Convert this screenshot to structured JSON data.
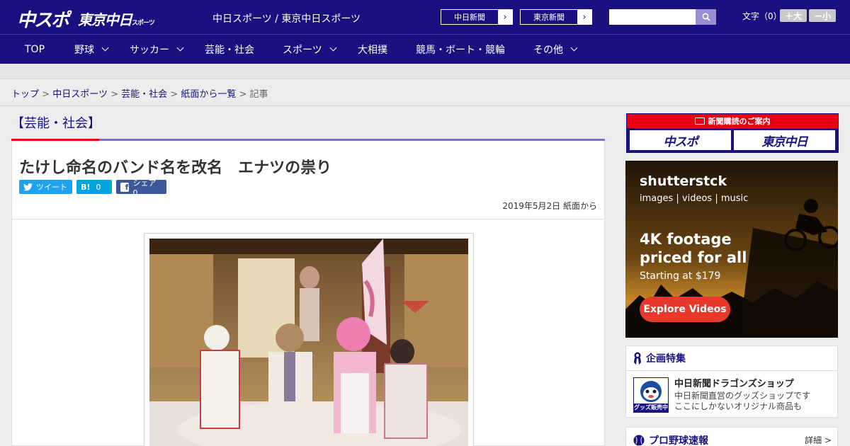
{
  "header": {
    "logo_main": "中スポ",
    "logo_tokyo": "東京中日",
    "logo_tokyo_small": "スポーツ",
    "tagline": "中日スポーツ / 東京中日スポーツ",
    "site_links": [
      {
        "label": "中日新聞",
        "arrow": "›"
      },
      {
        "label": "東京新聞",
        "arrow": "›"
      }
    ],
    "search_placeholder": "",
    "font_size_label": "文字（0）",
    "font_bigger": "＋大",
    "font_smaller": "－小"
  },
  "nav": {
    "items": [
      {
        "label": "TOP"
      },
      {
        "label": "野球"
      },
      {
        "label": "サッカー"
      },
      {
        "label": "芸能・社会"
      },
      {
        "label": "スポーツ"
      },
      {
        "label": "大相撲"
      },
      {
        "label": "競馬・ボート・競輪"
      },
      {
        "label": "その他"
      }
    ]
  },
  "breadcrumb": {
    "items": [
      "トップ",
      "中日スポーツ",
      "芸能・社会",
      "紙面から一覧"
    ],
    "current": "記事",
    "separator": ">"
  },
  "main": {
    "section": "【芸能・社会】",
    "headline": "たけし命名のバンド名を改名　エナツの祟り",
    "share": {
      "tweet": "ツイート",
      "hatena_icon": "B!",
      "hatena_count": "0",
      "facebook_icon": "f",
      "facebook_label": "シェア 0"
    },
    "date": "2019年5月2日 紙面から"
  },
  "sidebar": {
    "subscribe": {
      "title": "新聞購読のご案内",
      "logo_left": "中スポ",
      "logo_right": "東京中日"
    },
    "ad": {
      "brand": "shutterstck",
      "sub": "images  |  videos  |  music",
      "headline_1": "4K footage",
      "headline_2": "priced for all",
      "price": "Starting at $179",
      "cta": "Explore Videos"
    },
    "feature": {
      "title": "企画特集",
      "item_title": "中日新聞ドラゴンズショップ",
      "item_desc_1": "中日新聞直営のグッズショップです",
      "item_desc_2": "ここにしかないオリジナル商品も",
      "thumb_text": "グッズ販売中"
    },
    "baseball": {
      "title": "プロ野球速報",
      "more": "詳細 >"
    }
  },
  "colors": {
    "brand_navy": "#1a1180",
    "accent_red": "#e60012",
    "twitter": "#1da1f2",
    "hatena": "#00a4de",
    "facebook": "#3b5998"
  }
}
